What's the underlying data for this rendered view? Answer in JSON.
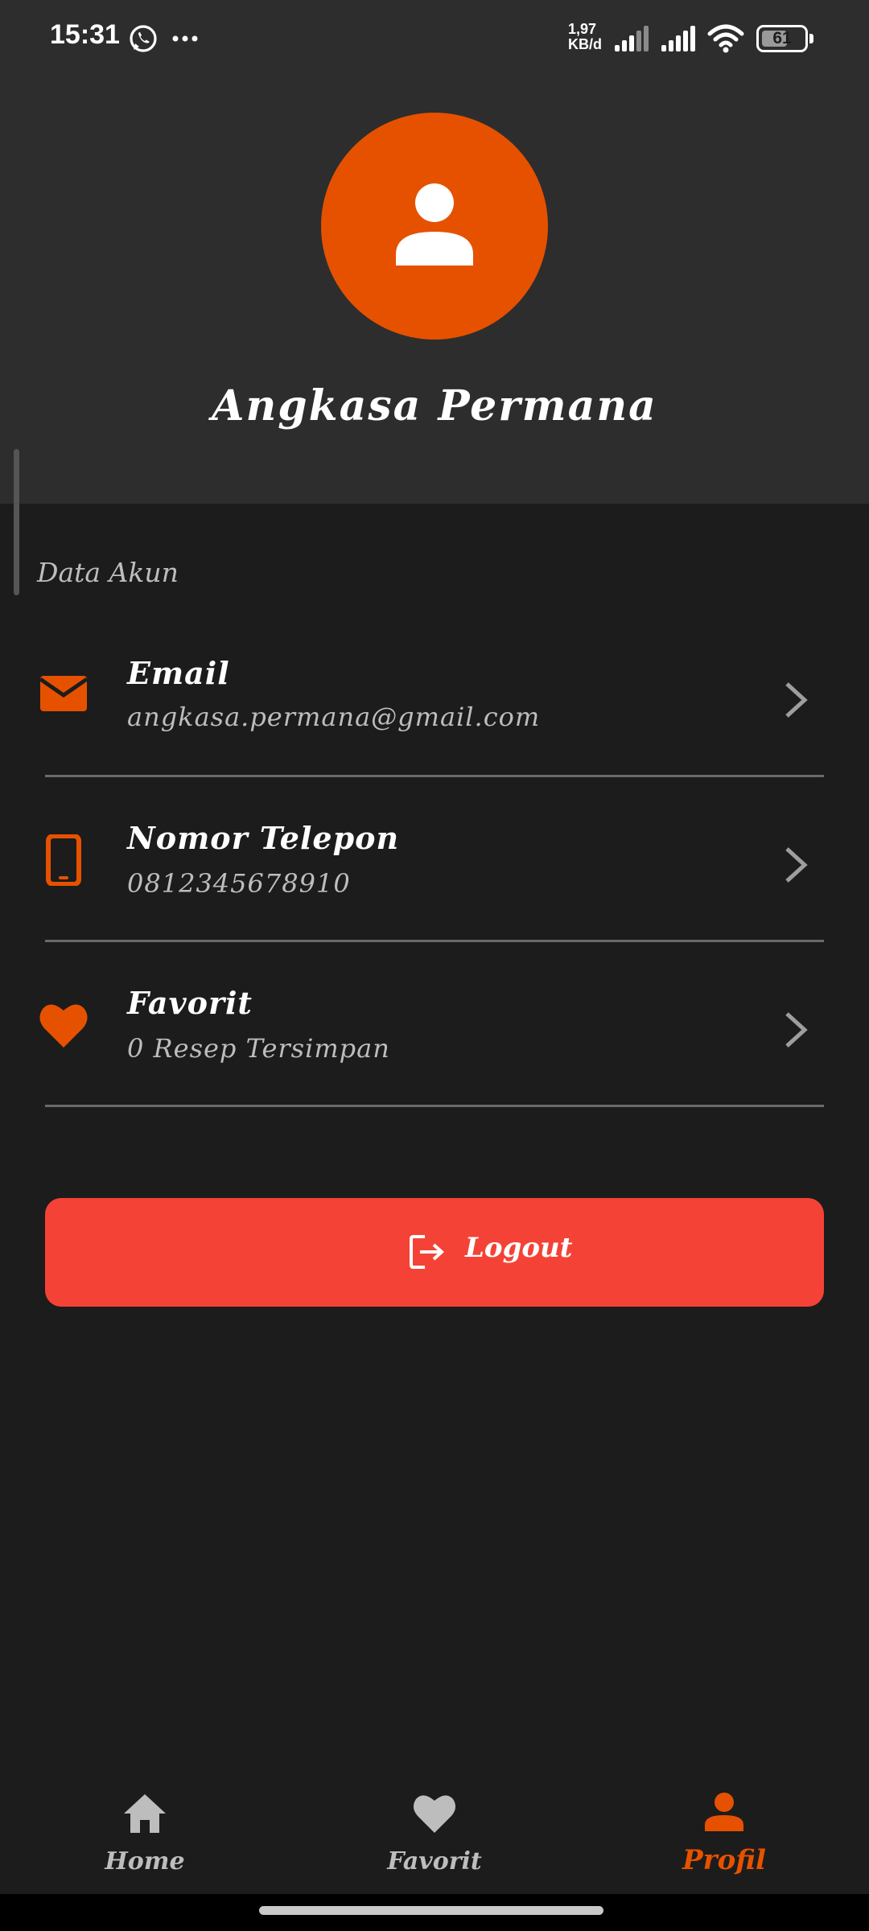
{
  "status_bar": {
    "time": "15:31",
    "net_speed_value": "1,97",
    "net_speed_unit": "KB/d",
    "battery_level": "61",
    "battery_fraction": 0.61,
    "icons": [
      "whatsapp-icon",
      "more-icon",
      "signal-icon",
      "signal-icon",
      "wifi-icon",
      "battery-icon"
    ]
  },
  "profile": {
    "name": "Angkasa Permana",
    "avatar_icon": "person-icon"
  },
  "section": {
    "label": "Data Akun"
  },
  "rows": [
    {
      "title": "Email",
      "value": "angkasa.permana@gmail.com",
      "icon": "email-icon"
    },
    {
      "title": "Nomor Telepon",
      "value": "0812345678910",
      "icon": "phone-icon"
    },
    {
      "title": "Favorit",
      "value": "0 Resep Tersimpan",
      "icon": "heart-icon"
    }
  ],
  "logout": {
    "label": "Logout",
    "icon": "logout-icon"
  },
  "bottom_nav": {
    "items": [
      {
        "label": "Home",
        "icon": "home-icon",
        "active": false
      },
      {
        "label": "Favorit",
        "icon": "heart-icon",
        "active": false
      },
      {
        "label": "Profil",
        "icon": "person-icon",
        "active": true
      }
    ]
  },
  "colors": {
    "accent": "#e65100",
    "logout": "#f44336",
    "background": "#1c1c1c",
    "header": "#2d2d2d",
    "muted_text": "#bdbdbd"
  }
}
